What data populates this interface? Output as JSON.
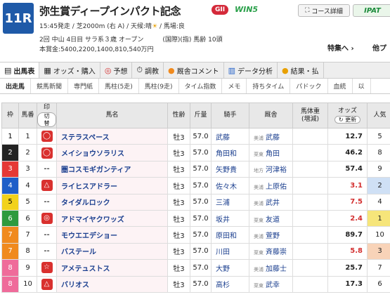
{
  "race": {
    "number": "11R",
    "title": "弥生賞ディープインパクト記念",
    "grade": "GII",
    "win5": "WIN5",
    "time_course": "15:45発走 / 芝2000m (右 A) / 天候:晴",
    "baba": " / 馬場:良",
    "conditions": "2回 中山 4日目 サラ系３歳 オープン　　　(国際)(指) 馬齢 10頭",
    "prize": "本賞金:5400,2200,1400,810,540万円"
  },
  "header_buttons": {
    "course": "コース詳細",
    "ipat": "IPAT"
  },
  "links": {
    "tokushu": "特集へ",
    "next": "他プ"
  },
  "tabs": [
    {
      "label": "出馬表",
      "icon": "▤"
    },
    {
      "label": "オッズ・購入",
      "icon": "▦"
    },
    {
      "label": "予想",
      "icon": "◎"
    },
    {
      "label": "調教",
      "icon": "⏱"
    },
    {
      "label": "厩舎コメント",
      "icon": "●"
    },
    {
      "label": "データ分析",
      "icon": "▥"
    },
    {
      "label": "結果・払",
      "icon": "●"
    }
  ],
  "subtabs": [
    "出走馬",
    "競馬新聞",
    "専門紙",
    "馬柱(5走)",
    "馬柱(9走)",
    "タイム指数",
    "メモ",
    "持ちタイム",
    "パドック",
    "血統",
    "以"
  ],
  "table_headers": {
    "waku": "枠",
    "umaban": "馬番",
    "mark": "印",
    "mark_sub": "切替",
    "name": "馬名",
    "sex_age": "性齢",
    "weight": "斤量",
    "jockey": "騎手",
    "trainer": "厩舎",
    "body": "馬体重",
    "body_sub": "(増減)",
    "odds": "オッズ",
    "odds_update": "更新",
    "pop": "人気"
  },
  "entries": [
    {
      "waku": "1",
      "umaban": "1",
      "mark": "◯",
      "name": "ステラスペース",
      "sex_age": "牡3",
      "weight": "57.0",
      "jockey": "武藤",
      "stable": "美浦",
      "trainer": "武藤",
      "odds": "12.7",
      "pop": "5"
    },
    {
      "waku": "2",
      "umaban": "2",
      "mark": "◯",
      "name": "メイショウソラリス",
      "sex_age": "牡3",
      "weight": "57.0",
      "jockey": "角田和",
      "stable": "栗東",
      "trainer": "角田",
      "odds": "46.2",
      "pop": "8"
    },
    {
      "waku": "3",
      "umaban": "3",
      "mark": "--",
      "name": "圏コスモギガンティア",
      "sex_age": "牡3",
      "weight": "57.0",
      "jockey": "矢野貴",
      "stable": "地方",
      "trainer": "河津裕",
      "odds": "57.4",
      "pop": "9"
    },
    {
      "waku": "4",
      "umaban": "4",
      "mark": "△",
      "name": "ライヒスアドラー",
      "sex_age": "牡3",
      "weight": "57.0",
      "jockey": "佐々木",
      "stable": "美浦",
      "trainer": "上原佑",
      "odds": "3.1",
      "pop": "2"
    },
    {
      "waku": "5",
      "umaban": "5",
      "mark": "--",
      "name": "タイダルロック",
      "sex_age": "牡3",
      "weight": "57.0",
      "jockey": "三浦",
      "stable": "美浦",
      "trainer": "武井",
      "odds": "7.5",
      "pop": "4"
    },
    {
      "waku": "6",
      "umaban": "6",
      "mark": "◎",
      "name": "アドマイヤクワッズ",
      "sex_age": "牡3",
      "weight": "57.0",
      "jockey": "坂井",
      "stable": "栗東",
      "trainer": "友道",
      "odds": "2.4",
      "pop": "1"
    },
    {
      "waku": "7",
      "umaban": "7",
      "mark": "--",
      "name": "モウエエデショー",
      "sex_age": "牡3",
      "weight": "57.0",
      "jockey": "原田和",
      "stable": "美浦",
      "trainer": "萱野",
      "odds": "89.7",
      "pop": "10"
    },
    {
      "waku": "7",
      "umaban": "8",
      "mark": "--",
      "name": "バステール",
      "sex_age": "牡3",
      "weight": "57.0",
      "jockey": "川田",
      "stable": "栗東",
      "trainer": "斉藤崇",
      "odds": "5.8",
      "pop": "3"
    },
    {
      "waku": "8",
      "umaban": "9",
      "mark": "☆",
      "name": "アメテュストス",
      "sex_age": "牡3",
      "weight": "57.0",
      "jockey": "大野",
      "stable": "美浦",
      "trainer": "加藤士",
      "odds": "25.7",
      "pop": "7"
    },
    {
      "waku": "8",
      "umaban": "10",
      "mark": "△",
      "name": "バリオス",
      "sex_age": "牡3",
      "weight": "57.0",
      "jockey": "高杉",
      "stable": "栗東",
      "trainer": "武幸",
      "odds": "17.3",
      "pop": "6"
    }
  ]
}
